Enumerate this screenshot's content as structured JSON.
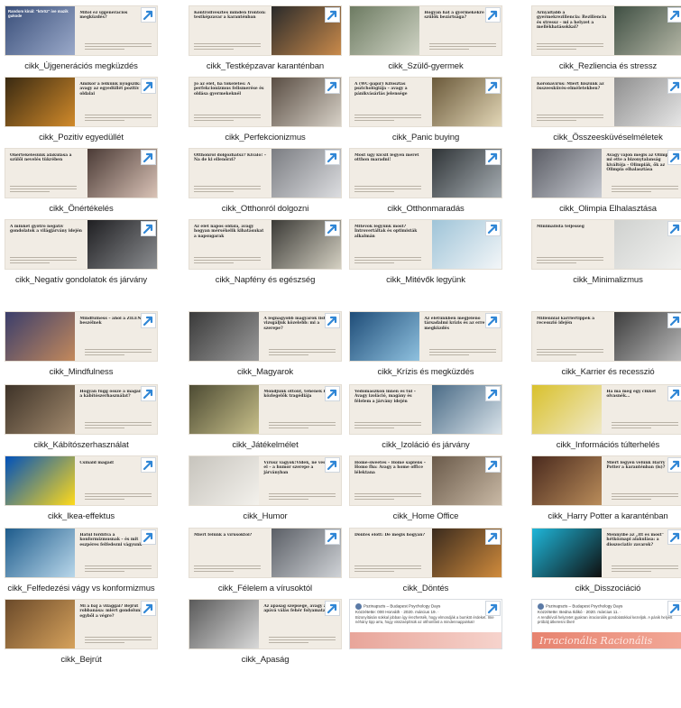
{
  "colors": {
    "thumb_bg": "#f1ece4",
    "shortcut_arrow": "#2f86d6",
    "label_text": "#1f1f1f"
  },
  "items": [
    {
      "label": "cikk_Újgenerációs megküzdés",
      "thumb_title": "Mitől ez újgenerációs megküzdés?",
      "image_side": "left",
      "image_colors": [
        "#3a4f7a",
        "#9aa9c9"
      ],
      "corner_text": "Random kínál: \"köröz\" ive mazik gukode"
    },
    {
      "label": "cikk_Testképzavar karanténban",
      "thumb_title": "Kontrollvesztés minden fronton: testképzavar a karanténban",
      "image_side": "right",
      "image_colors": [
        "#2a2a2a",
        "#c98a4b"
      ]
    },
    {
      "label": "cikk_Szülő-gyermek",
      "thumb_title": "Hogyan hat a gyermekekre a szülők bezártsága?",
      "image_side": "left",
      "image_colors": [
        "#6d7b62",
        "#cfd3c4"
      ]
    },
    {
      "label": "cikk_Rezliencia és stressz",
      "thumb_title": "Árnyaltabb a gyermekreziliencia: Reziliencia és stressz – mi a helyzet a mellékhatásokkal?",
      "image_side": "right",
      "image_colors": [
        "#3f4f43",
        "#b7b9a8"
      ]
    },
    {
      "label": "cikk_Pozitív egyedüllét",
      "thumb_title": "Amikor a lelkünk nyugszik: avagy az egyedüllét pozitív oldalai",
      "image_side": "left",
      "image_colors": [
        "#3a2a12",
        "#d18a2a"
      ]
    },
    {
      "label": "cikk_Perfekcionizmus",
      "thumb_title": "Jó az élet, ha tökéletes: A perfekcionizmus felismerése és oldása gyermekeknél",
      "image_side": "right",
      "image_colors": [
        "#5a4e44",
        "#d7d1c7"
      ]
    },
    {
      "label": "cikk_Panic buying",
      "thumb_title": "A (WC-papír) Kifosztás pszichológiája – avagy a pánikvásárlás jelensége",
      "image_side": "right",
      "image_colors": [
        "#6b5a3b",
        "#e2d6b6"
      ]
    },
    {
      "label": "cikk_Összeesküvéselméletek",
      "thumb_title": "Koronavírus: Miért hiszünk az összeesküvés-elméletekben?",
      "image_side": "right",
      "image_colors": [
        "#8f8f8f",
        "#e8e8e8"
      ]
    },
    {
      "label": "cikk_Önértékelés",
      "thumb_title": "Önértékelésünk alakulása a szülői nevelés tükrében",
      "image_side": "right",
      "image_colors": [
        "#4b3b36",
        "#d9c2b6"
      ]
    },
    {
      "label": "cikk_Otthonról dolgozni",
      "thumb_title": "Otthonról dolgozhatsz? Kiváló! – Na de ki ellenőrzi?",
      "image_side": "right",
      "image_colors": [
        "#7b7d82",
        "#dcdde0"
      ]
    },
    {
      "label": "cikk_Otthonmaradás",
      "thumb_title": "Most ugy kicsit legyen meret otthon maradni!",
      "image_side": "right",
      "image_colors": [
        "#2f3437",
        "#a7aeb3"
      ]
    },
    {
      "label": "cikk_Olimpia Elhalasztása",
      "thumb_title": "Avagy vajon mégis az Olimpia, mi ette a bizonytalanság kiváltója – Olimpiák, ők az Olimpia elhalasztása",
      "image_side": "left",
      "image_colors": [
        "#5a5c64",
        "#c7cad1"
      ]
    },
    {
      "label": "cikk_Negatív gondolatok és járvány",
      "thumb_title": "A minket gyötrő negatív gondolatok a világjárvány idején",
      "image_side": "right",
      "image_colors": [
        "#1f1f22",
        "#8b8d90"
      ]
    },
    {
      "label": "cikk_Napfény és egészség",
      "thumb_title": "Az élet napos oldala, avagy hogyan mérsékelik kihatásukat a napsugarak",
      "image_side": "right",
      "image_colors": [
        "#3b3a36",
        "#d4d0c2"
      ]
    },
    {
      "label": "cikk_Mitévők legyünk",
      "thumb_title": "Mitévők legyünk most? Introvertáltak és optimisták alkalmán",
      "image_side": "right",
      "image_colors": [
        "#9fc4d8",
        "#f3f6f8"
      ]
    },
    {
      "label": "cikk_Minimalizmus",
      "thumb_title": "Minimalista teljesség",
      "image_side": "right",
      "image_colors": [
        "#cfd1cf",
        "#f2f2f0"
      ]
    },
    {
      "label": "cikk_Mindfulness",
      "thumb_title": "Mindfulness – ahol a ZILENSZ beszélnek",
      "image_side": "left",
      "image_colors": [
        "#3b3e6b",
        "#c3895c"
      ]
    },
    {
      "label": "cikk_Magyarok",
      "thumb_title": "A legnagyobb magyarok listáját vizsgáljuk közelebb: mi a szerepe?",
      "image_side": "left",
      "image_colors": [
        "#3a3a3a",
        "#9a9a9a"
      ]
    },
    {
      "label": "cikk_Krízis és megküzdés",
      "thumb_title": "Az életünkben megjelenő társadalmi krízis és az erre való megküzdés",
      "image_side": "left",
      "image_colors": [
        "#1f4d78",
        "#8fc1df"
      ]
    },
    {
      "label": "cikk_Karrier és recesszió",
      "thumb_title": "Millennial karriertippek a recesszió idején",
      "image_side": "right",
      "image_colors": [
        "#3d3d3d",
        "#bcbcbc"
      ]
    },
    {
      "label": "cikk_Kábítószerhasználat",
      "thumb_title": "Hogyan függ össze a magány és a kábítószerhasználat?",
      "image_side": "left",
      "image_colors": [
        "#3e3328",
        "#a28a6e"
      ]
    },
    {
      "label": "cikk_Játékelmélet",
      "thumb_title": "Mondjunk ottont, tehenek ki! A közlegelők tragédiája",
      "image_side": "left",
      "image_colors": [
        "#4d4b33",
        "#c8c08a"
      ]
    },
    {
      "label": "cikk_Izoláció és járvány",
      "thumb_title": "Védőmaszkon innen és túl – Avagy izoláció, magány és félelem a járvány idején",
      "image_side": "right",
      "image_colors": [
        "#4a6b86",
        "#d9e3ea"
      ]
    },
    {
      "label": "cikk_Információs túlterhelés",
      "thumb_title": "Ha ma még egy cikket olvasnék...",
      "image_side": "left",
      "image_colors": [
        "#d9c12d",
        "#f0e9c8"
      ]
    },
    {
      "label": "cikk_Ikea-effektus",
      "thumb_title": "Csináld magad!",
      "image_side": "left",
      "image_colors": [
        "#0051ba",
        "#ffda1a"
      ]
    },
    {
      "label": "cikk_Humor",
      "thumb_title": "Vírusz vagyok!Vidék, ne vesztem el – a humor szerepe a járványban",
      "image_side": "left",
      "image_colors": [
        "#c7c4bd",
        "#f3f1ec"
      ]
    },
    {
      "label": "cikk_Home Office",
      "thumb_title": "Home-sweetes – Home sapiens – Homo fba: Avagy a home office lélektana",
      "image_side": "right",
      "image_colors": [
        "#6a5a4a",
        "#c9b9a5"
      ]
    },
    {
      "label": "cikk_Harry Potter a karanténban",
      "thumb_title": "Miért legyen velünk Harry Potter a karanténban (is)?",
      "image_side": "left",
      "image_colors": [
        "#4a2a1e",
        "#b98c5a"
      ]
    },
    {
      "label": "cikk_Felfedezési vágy vs konformizmus",
      "thumb_title": "Hátul fordítva a konformizmusnak – és mit eszpéres felfedezni vágyunk",
      "image_side": "left",
      "image_colors": [
        "#1e5c8c",
        "#b9d7ea"
      ]
    },
    {
      "label": "cikk_Félelem a vírusoktól",
      "thumb_title": "Miért félünk a vírusoktól?",
      "image_side": "right",
      "image_colors": [
        "#5b5f66",
        "#cfd2d6"
      ]
    },
    {
      "label": "cikk_Döntés",
      "thumb_title": "Döntés előtt: De mégis hogyan?",
      "image_side": "right",
      "image_colors": [
        "#3b2b1e",
        "#d08b3c"
      ]
    },
    {
      "label": "cikk_Disszociáció",
      "thumb_title": "Mennyibe az „itt és most” hétköznapi alakulása: a disszociatív zavarok?",
      "image_side": "left",
      "image_colors": [
        "#1fb6d9",
        "#0f0f0f"
      ]
    },
    {
      "label": "cikk_Bejrút",
      "thumb_title": "Mi a baj a világgal? Bejrút robbanása: miért gondolunk egyből a végre?",
      "image_side": "left",
      "image_colors": [
        "#6b4a2a",
        "#d6a25c"
      ]
    },
    {
      "label": "cikk_Apaság",
      "thumb_title": "Az apaság szépsége, avagy az apává válás fehér folyamatai",
      "image_side": "left",
      "image_colors": [
        "#5a5a5a",
        "#d9d9d9"
      ]
    },
    {
      "label": "",
      "post": true,
      "post_header": "Pszinapszis – Budapest Psychology Days",
      "post_sub": "Közzétette: 000 Horváth · 2020. március 19. ·",
      "post_text": "Bizonyításán sokkal jobban így érezhetsék, hogy elmondják a bumköt érdeket. Íme néhány tipp arra, hogy visszaépítsük az otthonfást a mindennapjainkat!",
      "banner_colors": [
        "#e8a59a",
        "#f6d3cc"
      ],
      "banner_text": ""
    },
    {
      "label": "",
      "post": true,
      "post_header": "Pszinapszis – Budapest Psychology Days",
      "post_sub": "Közzétette: Bedna Ildikó · 2020. március 11. ·",
      "post_text": "A rendkívüli helyzetet gyakran irracionális gondolatokkal kezeljük. A pánik helyett próbálj átkeresni őket!",
      "banner_colors": [
        "#e7836f",
        "#f2a897"
      ],
      "banner_text": "Irracionális Racionális"
    }
  ]
}
